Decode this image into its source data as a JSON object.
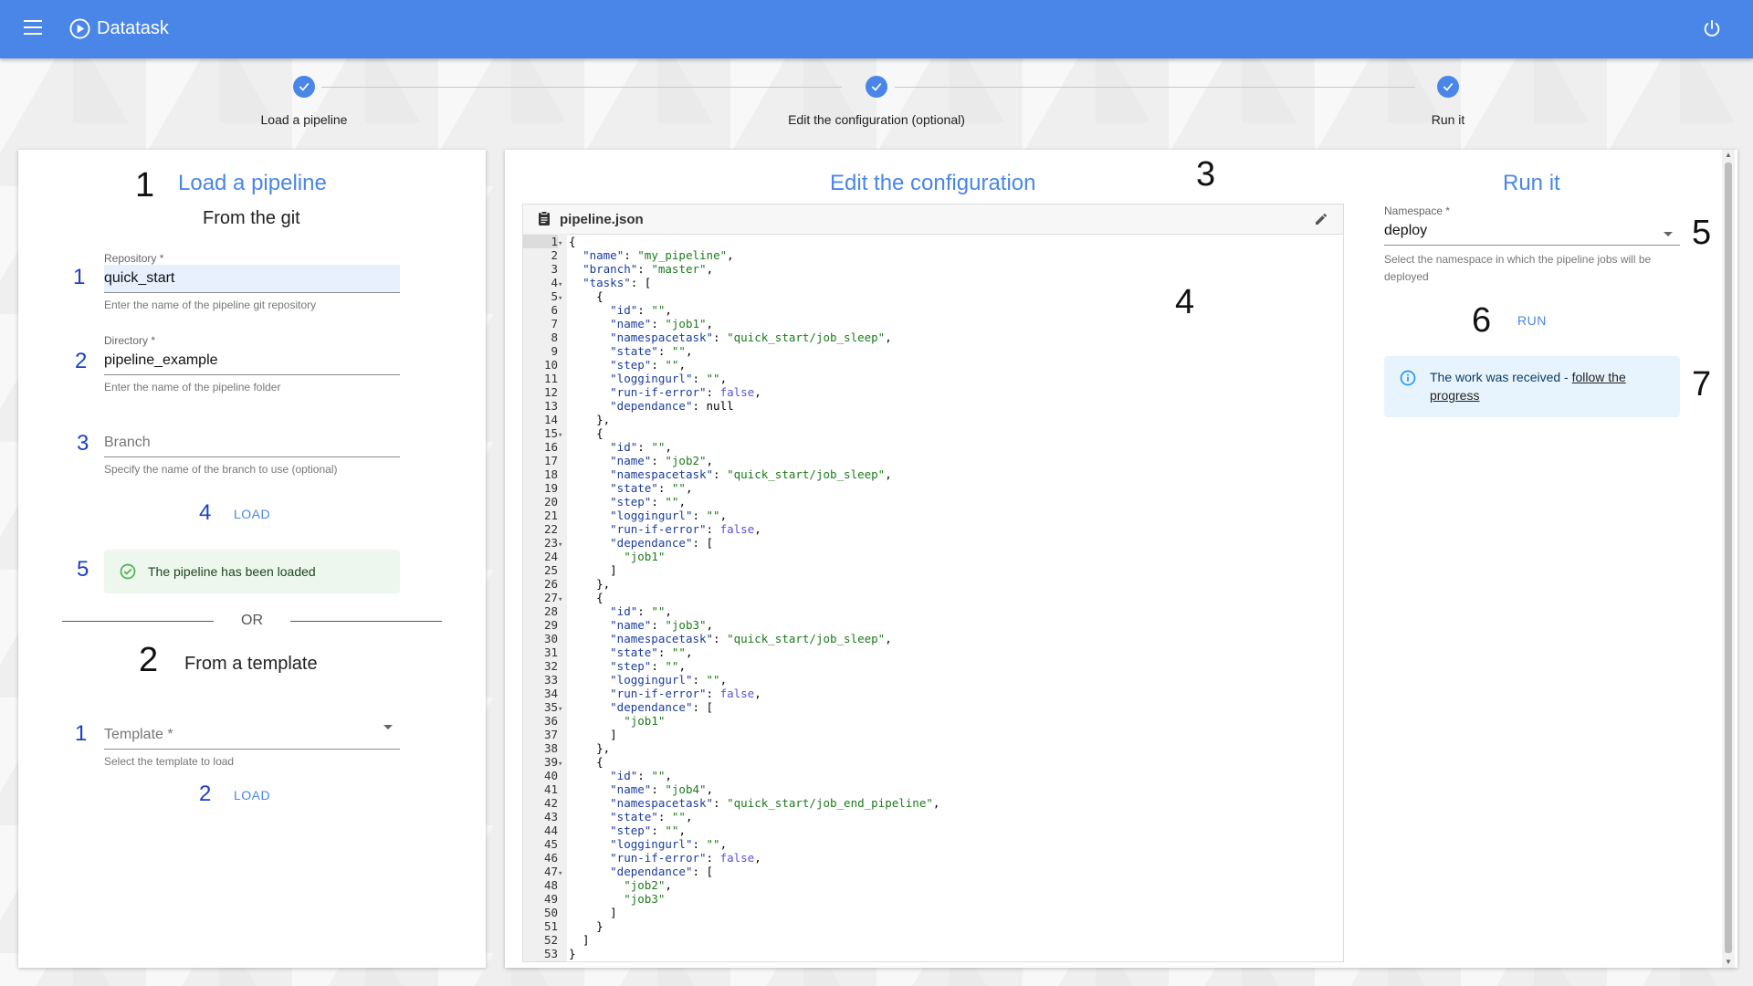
{
  "appbar": {
    "title": "Datatask"
  },
  "stepper": [
    {
      "label": "Load a pipeline"
    },
    {
      "label": "Edit the configuration (optional)"
    },
    {
      "label": "Run it"
    }
  ],
  "annotations": {
    "load_card": "1",
    "repo": "1",
    "dir": "2",
    "branch": "3",
    "load_btn": "4",
    "success": "5",
    "template_section": "2",
    "template_field": "1",
    "template_load": "2",
    "edit_heading": "3",
    "editor": "4",
    "namespace": "5",
    "run": "6",
    "info": "7"
  },
  "load_card": {
    "title": "Load a pipeline",
    "git_subtitle": "From the git",
    "repository": {
      "label": "Repository *",
      "value": "quick_start",
      "help": "Enter the name of the pipeline git repository"
    },
    "directory": {
      "label": "Directory *",
      "value": "pipeline_example",
      "help": "Enter the name of the pipeline folder"
    },
    "branch": {
      "placeholder": "Branch",
      "help": "Specify the name of the branch to use (optional)"
    },
    "load_label": "LOAD",
    "success_message": "The pipeline has been loaded",
    "or_text": "OR",
    "template_subtitle": "From a template",
    "template": {
      "placeholder": "Template *",
      "help": "Select the template to load"
    },
    "template_load_label": "LOAD"
  },
  "edit_card": {
    "title": "Edit the configuration",
    "filename": "pipeline.json",
    "icons": {
      "file": "clipboard-icon",
      "edit": "pencil-icon"
    },
    "code_lines": [
      "{",
      "  \"name\": \"my_pipeline\",",
      "  \"branch\": \"master\",",
      "  \"tasks\": [",
      "    {",
      "      \"id\": \"\",",
      "      \"name\": \"job1\",",
      "      \"namespacetask\": \"quick_start/job_sleep\",",
      "      \"state\": \"\",",
      "      \"step\": \"\",",
      "      \"loggingurl\": \"\",",
      "      \"run-if-error\": false,",
      "      \"dependance\": null",
      "    },",
      "    {",
      "      \"id\": \"\",",
      "      \"name\": \"job2\",",
      "      \"namespacetask\": \"quick_start/job_sleep\",",
      "      \"state\": \"\",",
      "      \"step\": \"\",",
      "      \"loggingurl\": \"\",",
      "      \"run-if-error\": false,",
      "      \"dependance\": [",
      "        \"job1\"",
      "      ]",
      "    },",
      "    {",
      "      \"id\": \"\",",
      "      \"name\": \"job3\",",
      "      \"namespacetask\": \"quick_start/job_sleep\",",
      "      \"state\": \"\",",
      "      \"step\": \"\",",
      "      \"loggingurl\": \"\",",
      "      \"run-if-error\": false,",
      "      \"dependance\": [",
      "        \"job1\"",
      "      ]",
      "    },",
      "    {",
      "      \"id\": \"\",",
      "      \"name\": \"job4\",",
      "      \"namespacetask\": \"quick_start/job_end_pipeline\",",
      "      \"state\": \"\",",
      "      \"step\": \"\",",
      "      \"loggingurl\": \"\",",
      "      \"run-if-error\": false,",
      "      \"dependance\": [",
      "        \"job2\",",
      "        \"job3\"",
      "      ]",
      "    }",
      "  ]",
      "}"
    ],
    "fold_lines": [
      1,
      4,
      5,
      15,
      23,
      27,
      35,
      39,
      47
    ]
  },
  "run_card": {
    "title": "Run it",
    "namespace": {
      "label": "Namespace *",
      "value": "deploy",
      "help": "Select the namespace in which the pipeline jobs will be deployed"
    },
    "run_label": "RUN",
    "info_text": "The work was received - ",
    "info_link": "follow the progress"
  },
  "colors": {
    "primary": "#4a86e8",
    "success_bg": "#edf7ee",
    "info_bg": "#e8f4fd",
    "annotation_blue": "#1a40c8"
  }
}
